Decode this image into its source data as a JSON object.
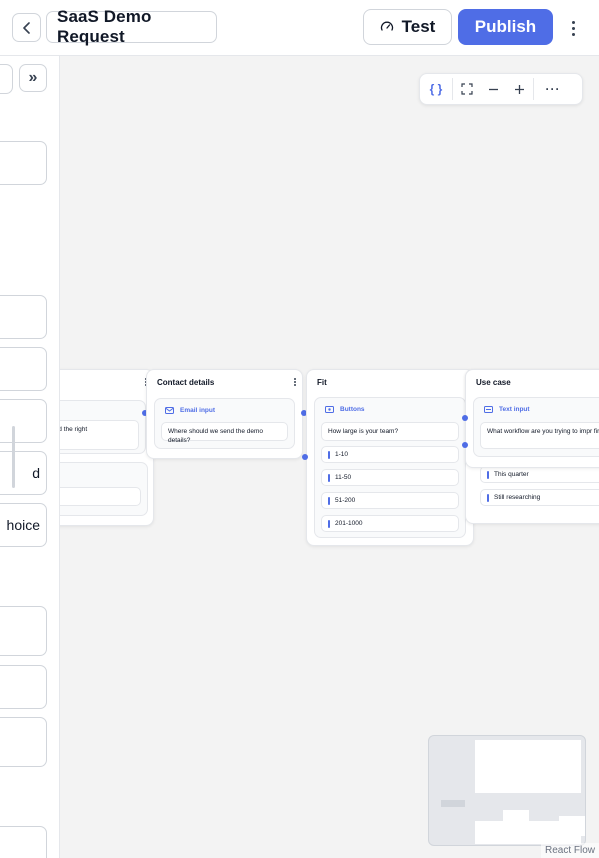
{
  "header": {
    "title": "SaaS Demo Request",
    "test_label": "Test",
    "publish_label": "Publish"
  },
  "sidebar": {
    "partial_blocks": [
      "d",
      "hoice"
    ]
  },
  "nodes": {
    "left_partial": {
      "q1": "u find the right",
      "q2": "e?"
    },
    "contact": {
      "title": "Contact details",
      "block_type": "Email input",
      "question": "Where should we send the demo details?"
    },
    "fit": {
      "title": "Fit",
      "block_type": "Buttons",
      "question": "How large is your team?",
      "options": [
        "1-10",
        "11-50",
        "51-200",
        "201-1000"
      ]
    },
    "use_case": {
      "title": "Use case",
      "block_type": "Text input",
      "question": "What workflow are you trying to impr first?",
      "options": [
        "This quarter",
        "Still researching"
      ]
    }
  },
  "attribution": "React Flow",
  "colors": {
    "accent": "#4f6de6",
    "canvas": "#f3f3f3"
  }
}
